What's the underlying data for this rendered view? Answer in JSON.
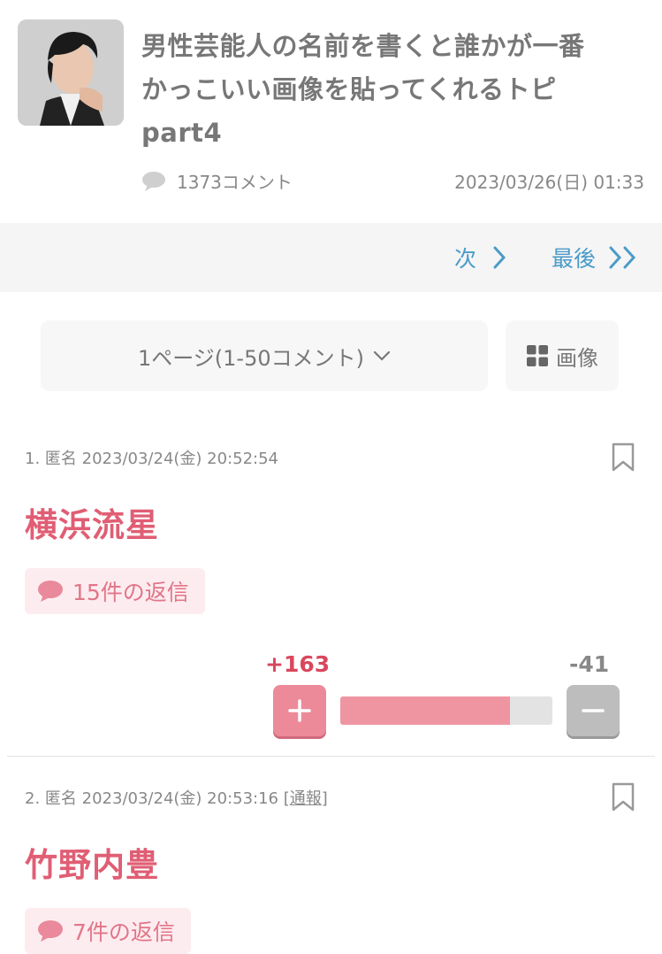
{
  "topic": {
    "title_line1": "男性芸能人の名前を書くと誰かが一番",
    "title_line2": "かっこいい画像を貼ってくれるトピ",
    "title_line3": "part4",
    "comment_count": "1373コメント",
    "date": "2023/03/26(日) 01:33"
  },
  "pager": {
    "next_label": "次",
    "last_label": "最後",
    "page_select_label": "1ページ(1-50コメント)",
    "image_label": "画像"
  },
  "comments": [
    {
      "number": "1.",
      "author": "匿名",
      "timestamp": "2023/03/24(金) 20:52:54",
      "report_label": "",
      "body": "横浜流星",
      "replies": "15件の返信",
      "plus": "+163",
      "minus": "-41",
      "plus_ratio": 0.8
    },
    {
      "number": "2.",
      "author": "匿名",
      "timestamp": "2023/03/24(金) 20:53:16",
      "report_label": "通報",
      "body": "竹野内豊",
      "replies": "7件の返信"
    }
  ],
  "colors": {
    "accent_pink": "#e05e74",
    "link_blue": "#4b9bc8",
    "vote_plus": "#ec8a9a",
    "vote_minus": "#bdbdbd"
  },
  "icons": [
    "avatar-thumbnail",
    "speech-bubble-icon",
    "chevron-right-icon",
    "double-chevron-right-icon",
    "chevron-down-icon",
    "grid-icon",
    "bookmark-icon",
    "plus-icon",
    "minus-icon"
  ]
}
